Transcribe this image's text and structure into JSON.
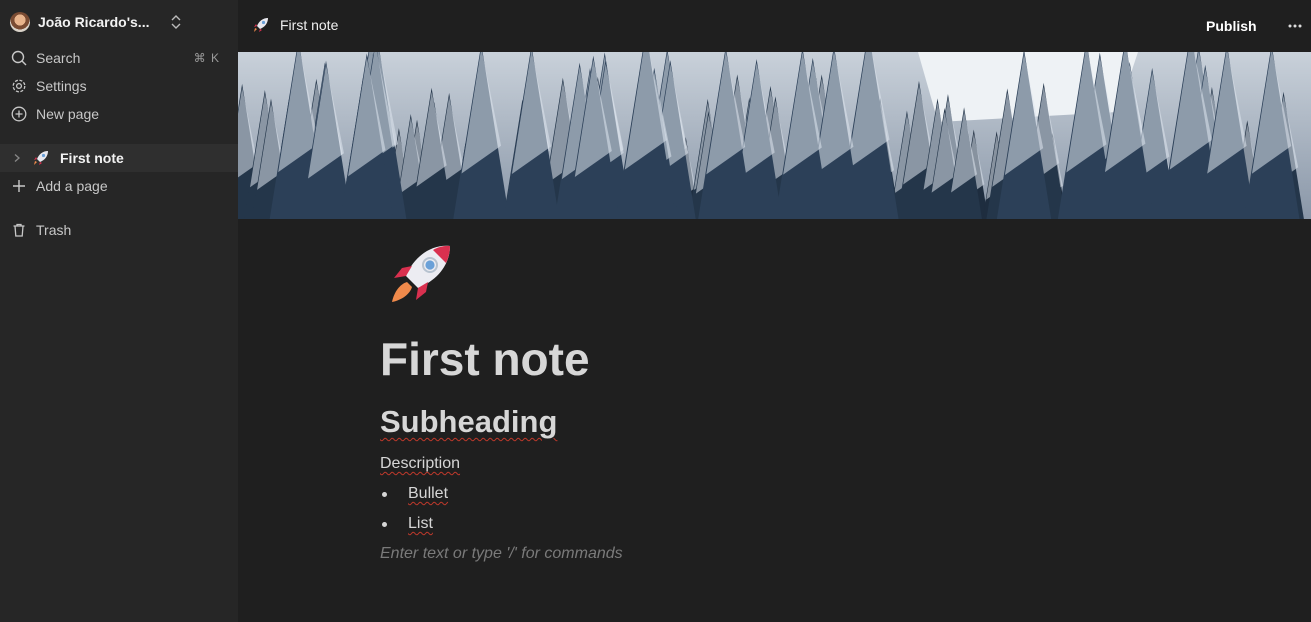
{
  "sidebar": {
    "workspace_name": "João Ricardo's...",
    "search": {
      "label": "Search",
      "shortcut": "⌘ K"
    },
    "settings_label": "Settings",
    "new_page_label": "New page",
    "pages": [
      {
        "icon": "rocket-emoji",
        "label": "First note"
      }
    ],
    "add_page_label": "Add a page",
    "trash_label": "Trash"
  },
  "topbar": {
    "breadcrumb": "First note",
    "publish_label": "Publish",
    "more_icon": "ellipsis-icon"
  },
  "document": {
    "icon": "rocket-emoji",
    "title": "First note",
    "subheading": "Subheading",
    "description": "Description",
    "bullets": [
      "Bullet",
      "List"
    ],
    "placeholder": "Enter text or type '/' for commands"
  },
  "colors": {
    "background": "#1f1f1f",
    "sidebar": "#262626",
    "selected_item": "#2f2f2f",
    "spellcheck": "#c0392b"
  }
}
